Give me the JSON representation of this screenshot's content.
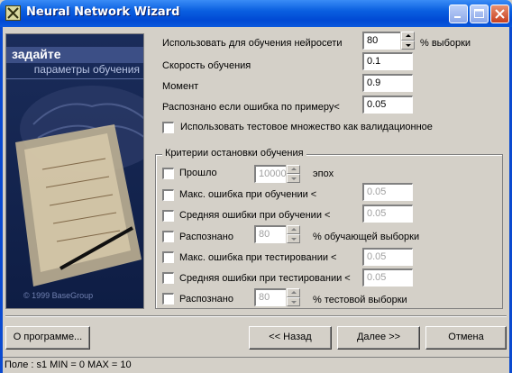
{
  "window": {
    "title": "Neural Network Wizard",
    "controls": [
      "minimize-icon",
      "maximize-icon",
      "close-icon"
    ]
  },
  "banner": {
    "heading": "задайте",
    "subheading": "параметры обучения",
    "copyright": "© 1999 BaseGroup"
  },
  "params": {
    "train_percent_label": "Использовать для обучения нейросети",
    "train_percent_value": "80",
    "train_percent_suffix": "% выборки",
    "learning_rate_label": "Скорость обучения",
    "learning_rate_value": "0.1",
    "momentum_label": "Момент",
    "momentum_value": "0.9",
    "recognized_label": "Распознано если ошибка по примеру<",
    "recognized_value": "0.05",
    "use_test_label": "Использовать тестовое множество как валидационное"
  },
  "stop": {
    "title": "Критерии остановки обучения",
    "epochs_label": "Прошло",
    "epochs_value": "10000",
    "epochs_suffix": "эпох",
    "max_train_label": "Макс. ошибка при обучении <",
    "max_train_value": "0.05",
    "avg_train_label": "Средняя ошибки при обучении <",
    "avg_train_value": "0.05",
    "rec_train_label": "Распознано",
    "rec_train_value": "80",
    "rec_train_suffix": "% обучающей выборки",
    "max_test_label": "Макс. ошибка при тестировании <",
    "max_test_value": "0.05",
    "avg_test_label": "Средняя ошибки при тестировании <",
    "avg_test_value": "0.05",
    "rec_test_label": "Распознано",
    "rec_test_value": "80",
    "rec_test_suffix": "% тестовой выборки"
  },
  "buttons": {
    "about": "О программе...",
    "back": "<< Назад",
    "next": "Далее >>",
    "cancel": "Отмена"
  },
  "status": {
    "text": "Поле : s1  MIN = 0 MAX = 10"
  }
}
